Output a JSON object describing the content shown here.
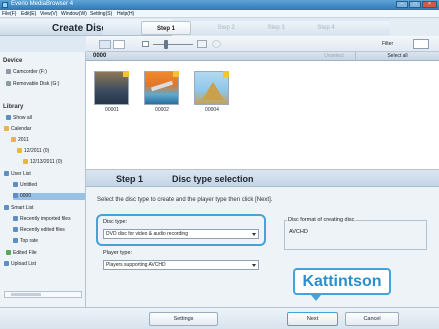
{
  "window": {
    "title": "Everio MediaBrowser 4"
  },
  "menu": [
    "File(F)",
    "Edit(E)",
    "View(V)",
    "Window(W)",
    "Setting(S)",
    "Help(H)"
  ],
  "header": {
    "title": "Create Disc"
  },
  "steps": [
    "Step 1",
    "Step 2",
    "Step 3",
    "Step 4"
  ],
  "toolbar": {
    "filter_label": "Filter"
  },
  "sidebar": {
    "device_heading": "Device",
    "devices": [
      "Camcorder (F:)",
      "Removable Disk (G:)"
    ],
    "library_heading": "Library",
    "items": [
      {
        "label": "Show all",
        "icon": "image-icon"
      },
      {
        "label": "Calendar",
        "icon": "calendar-icon"
      },
      {
        "label": "2011",
        "icon": "calendar-icon"
      },
      {
        "label": "12/2011 (0)",
        "icon": "calendar-icon"
      },
      {
        "label": "12/13/2011 (0)",
        "icon": "calendar-icon"
      },
      {
        "label": "User List",
        "icon": "user-list-icon"
      },
      {
        "label": "Untitled",
        "icon": "list-icon"
      },
      {
        "label": "0000",
        "icon": "list-icon"
      },
      {
        "label": "Smart List",
        "icon": "smart-list-icon"
      },
      {
        "label": "Recently imported files",
        "icon": "list-icon"
      },
      {
        "label": "Recently edited files",
        "icon": "list-icon"
      },
      {
        "label": "Top rate",
        "icon": "list-icon"
      },
      {
        "label": "Edited File",
        "icon": "edited-file-icon"
      },
      {
        "label": "Upload List",
        "icon": "upload-icon"
      }
    ]
  },
  "media": {
    "folder_name": "0000",
    "unselect_label": "Unselect",
    "select_all_label": "Select all",
    "thumbnails": [
      {
        "label": "00001"
      },
      {
        "label": "00002"
      },
      {
        "label": "00004"
      }
    ]
  },
  "step_panel": {
    "step_number": "Step 1",
    "title": "Disc type selection",
    "instruction": "Select the disc type to create and the player type then click [Next].",
    "disc_type_label": "Disc type:",
    "disc_type_value": "DVD disc for video & audio recording",
    "player_type_label": "Player type:",
    "player_type_value": "Players supporting AVCHD",
    "format_label": "Disc format of creating disc",
    "format_value": "AVCHD"
  },
  "callout": {
    "text": "Kattintson"
  },
  "buttons": {
    "settings": "Settings",
    "next": "Next",
    "cancel": "Cancel"
  },
  "colors": {
    "accent": "#46a3d9",
    "titlebar": "#2e78b7",
    "selection": "#99c1e6"
  }
}
